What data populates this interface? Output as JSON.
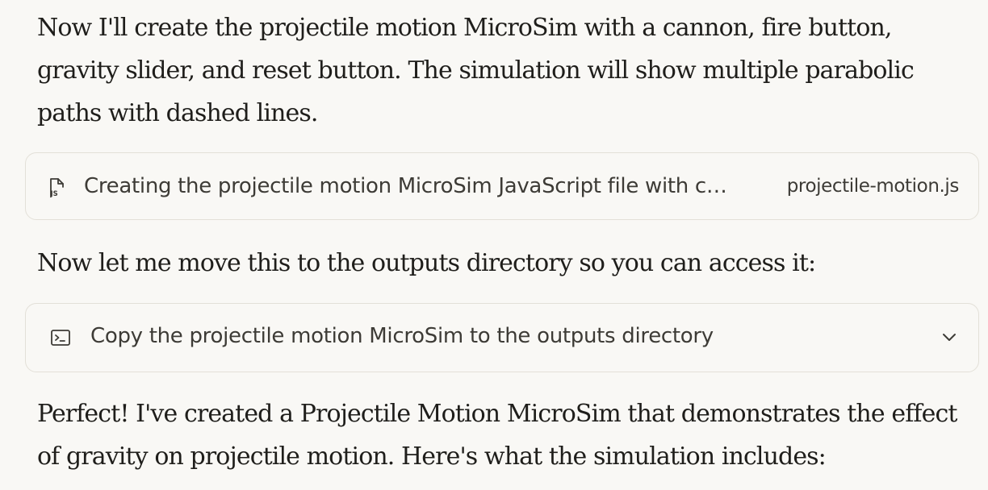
{
  "messages": {
    "intro": "Now I'll create the projectile motion MicroSim with a cannon, fire button, gravity slider, and reset button. The simulation will show multiple parabolic paths with dashed lines.",
    "move_note": "Now let me move this to the outputs directory so you can access it:",
    "summary": "Perfect! I've created a Projectile Motion MicroSim that demonstrates the effect of gravity on projectile motion. Here's what the simulation includes:"
  },
  "tool_calls": [
    {
      "icon": "js-file-icon",
      "label": "Creating the projectile motion MicroSim JavaScript file with c…",
      "file": "projectile-motion.js"
    },
    {
      "icon": "terminal-icon",
      "label": "Copy the projectile motion MicroSim to the outputs directory",
      "expand_icon": "chevron-down-icon"
    }
  ],
  "colors": {
    "background": "#f9f8f5",
    "text": "#1f1e1b",
    "card_border": "#e3e0d8",
    "card_text": "#3d3b36"
  }
}
